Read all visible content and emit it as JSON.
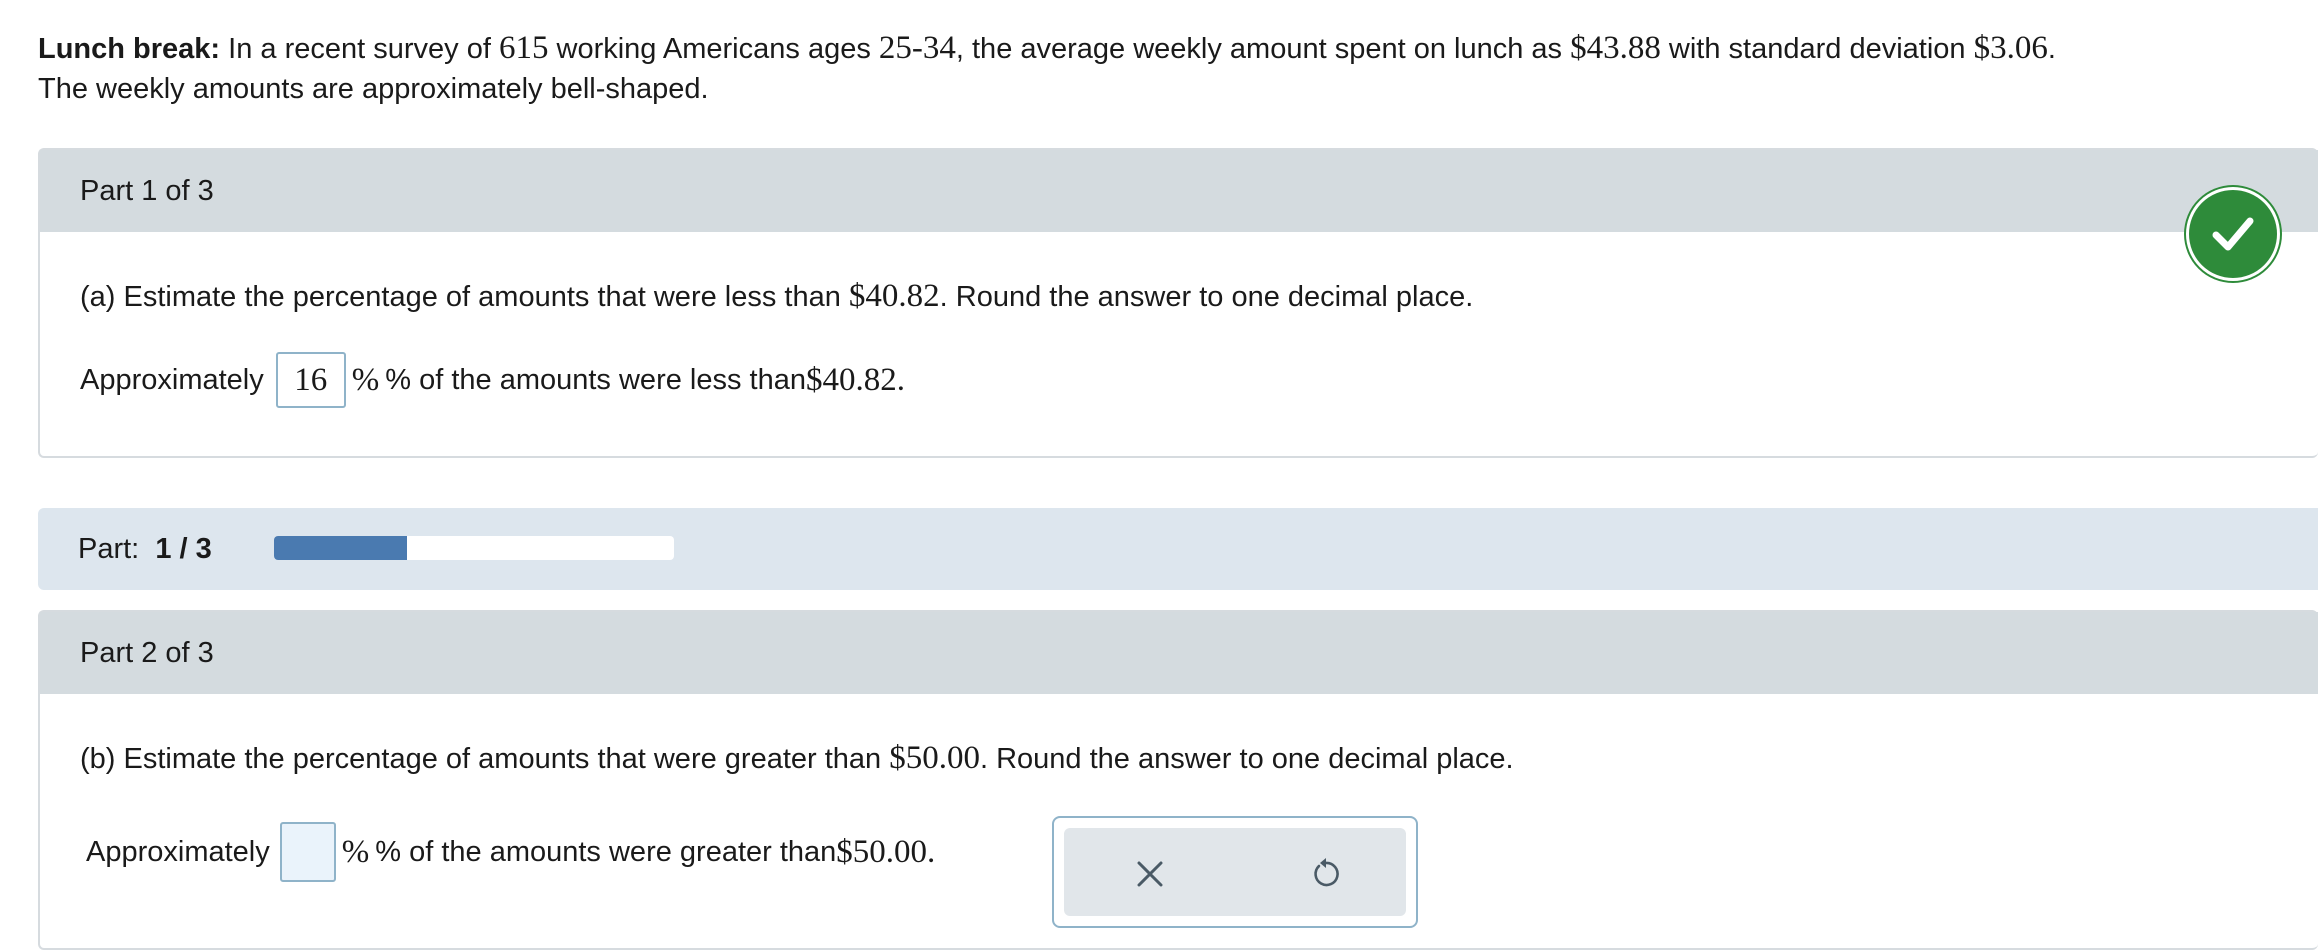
{
  "intro": {
    "title": "Lunch break:",
    "t1": " In a recent survey of ",
    "n": "615",
    "t2": " working Americans ages ",
    "ages": "25-34",
    "t3": ", the average weekly amount spent on lunch as ",
    "mean": "$43.88",
    "t4": " with standard deviation ",
    "sd": "$3.06",
    "t5": ".",
    "line2": "The weekly amounts are approximately bell-shaped."
  },
  "part1": {
    "header": "Part 1 of 3",
    "q_prefix": "(a) Estimate the percentage of amounts that were less than ",
    "q_value": "$40.82",
    "q_suffix": ". Round the answer to one decimal place.",
    "ans_prefix": "Approximately",
    "ans_value": "16",
    "ans_suffix": "% of the amounts were less than ",
    "ans_amount": "$40.82",
    "ans_end": "."
  },
  "progress": {
    "label": "Part:",
    "value": "1 / 3",
    "fraction": 0.3333,
    "color": "#4a7ab0"
  },
  "part2": {
    "header": "Part 2 of 3",
    "q_prefix": "(b) Estimate the percentage of amounts that were greater than ",
    "q_value": "$50.00",
    "q_suffix": ". Round the answer to one decimal place.",
    "ans_prefix": "Approximately",
    "ans_value": "",
    "ans_suffix": "% of the amounts were greater than ",
    "ans_amount": "$50.00",
    "ans_end": "."
  },
  "tools": {
    "clear_icon": "close-icon",
    "undo_icon": "undo-icon"
  },
  "colors": {
    "correct": "#2e8b3a",
    "header_bg": "#d4dbdf",
    "progress_bg": "#dde6ee"
  }
}
